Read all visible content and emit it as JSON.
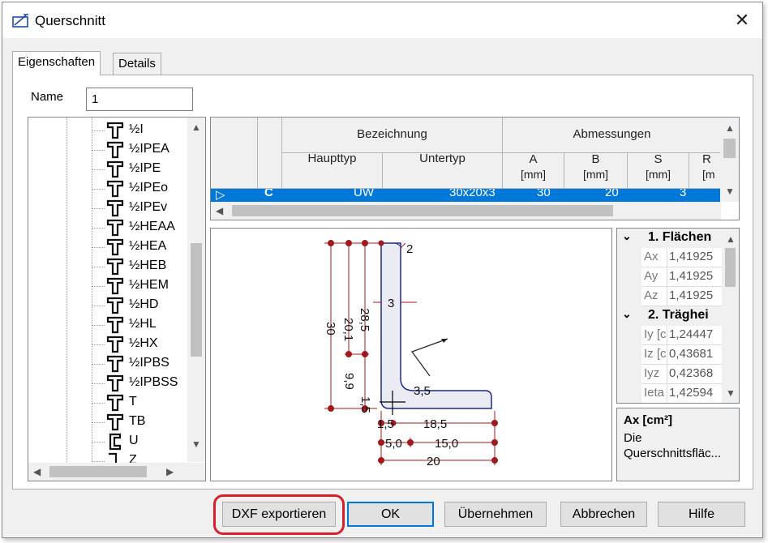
{
  "window": {
    "title": "Querschnitt",
    "close_glyph": "✕"
  },
  "tabs": [
    {
      "label": "Eigenschaften",
      "active": true
    },
    {
      "label": "Details",
      "active": false
    }
  ],
  "name_field": {
    "label": "Name",
    "value": "1"
  },
  "tree": {
    "items": [
      {
        "label": "½I",
        "icon": "t-profile-icon"
      },
      {
        "label": "½IPEA",
        "icon": "t-profile-icon"
      },
      {
        "label": "½IPE",
        "icon": "t-profile-icon"
      },
      {
        "label": "½IPEo",
        "icon": "t-profile-icon"
      },
      {
        "label": "½IPEv",
        "icon": "t-profile-icon"
      },
      {
        "label": "½HEAA",
        "icon": "t-profile-icon"
      },
      {
        "label": "½HEA",
        "icon": "t-profile-icon"
      },
      {
        "label": "½HEB",
        "icon": "t-profile-icon"
      },
      {
        "label": "½HEM",
        "icon": "t-profile-icon"
      },
      {
        "label": "½HD",
        "icon": "t-profile-icon"
      },
      {
        "label": "½HL",
        "icon": "t-profile-icon"
      },
      {
        "label": "½HX",
        "icon": "t-profile-icon"
      },
      {
        "label": "½IPBS",
        "icon": "t-profile-icon"
      },
      {
        "label": "½IPBSS",
        "icon": "t-profile-icon"
      },
      {
        "label": "T",
        "icon": "t-profile-icon"
      },
      {
        "label": "TB",
        "icon": "t-profile-icon"
      },
      {
        "label": "U",
        "icon": "u-profile-icon"
      },
      {
        "label": "Z",
        "icon": "z-profile-icon"
      }
    ]
  },
  "grid": {
    "group_headers": {
      "designation": "Bezeichnung",
      "dimensions": "Abmessungen"
    },
    "columns": [
      {
        "title": "Haupttyp",
        "unit": ""
      },
      {
        "title": "Untertyp",
        "unit": ""
      },
      {
        "title": "A",
        "unit": "[mm]"
      },
      {
        "title": "B",
        "unit": "[mm]"
      },
      {
        "title": "S",
        "unit": "[mm]"
      },
      {
        "title": "R",
        "unit": "[m"
      }
    ],
    "selected_row": {
      "marker": "▷",
      "code": "C",
      "haupttyp": "UW",
      "untertyp": "30x20x3",
      "a": "30",
      "b": "20",
      "s": "3"
    }
  },
  "drawing": {
    "labels": {
      "radius_top": "2",
      "thickness": "3",
      "dim_20_1": "20,1",
      "dim_28_5": "28,5",
      "dim_30": "30",
      "dim_9_9": "9,9",
      "dim_1_5_v": "1,5",
      "radius_inner": "3,5",
      "dim_1_5_h": "1,5",
      "dim_18_5": "18,5",
      "dim_5_0": "5,0",
      "dim_15_0": "15,0",
      "dim_20": "20"
    },
    "colors": {
      "dimension": "#a0191e",
      "profile": "#1f2a8c",
      "fill": "#e8e8f0"
    }
  },
  "properties": {
    "categories": [
      {
        "label": "1. Flächen",
        "rows": [
          {
            "name": "Ax",
            "value": "1,41925"
          },
          {
            "name": "Ay",
            "value": "1,41925"
          },
          {
            "name": "Az",
            "value": "1,41925"
          }
        ]
      },
      {
        "label": "2. Träghei",
        "rows": [
          {
            "name": "Iy [c",
            "value": "1,24447"
          },
          {
            "name": "Iz [c",
            "value": "0,43681"
          },
          {
            "name": "Iyz",
            "value": "0,42368"
          },
          {
            "name": "Ieta",
            "value": "1,42594"
          }
        ]
      }
    ],
    "description": {
      "title": "Ax [cm²]",
      "text_line1": "Die",
      "text_line2": "Querschnittsfläc..."
    }
  },
  "buttons": {
    "dxf_export": "DXF exportieren",
    "ok": "OK",
    "apply": "Übernehmen",
    "cancel": "Abbrechen",
    "help": "Hilfe"
  }
}
